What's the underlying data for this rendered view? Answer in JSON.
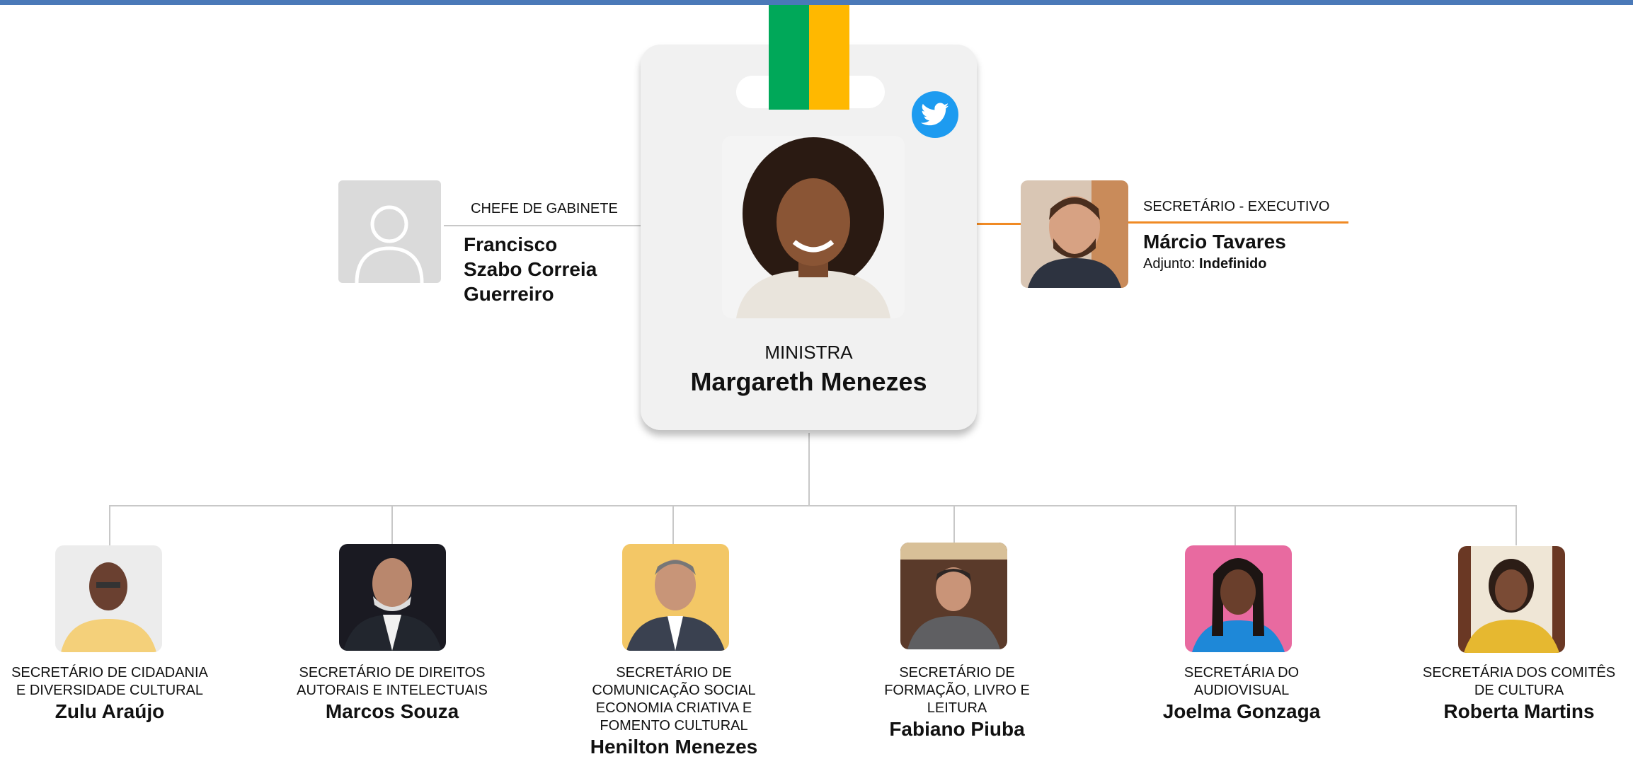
{
  "minister": {
    "role": "MINISTRA",
    "name": "Margareth Menezes",
    "social_icon": "twitter-bird-icon"
  },
  "chief_of_staff": {
    "role": "CHEFE DE GABINETE",
    "name_lines": [
      "Francisco",
      "Szabo Correia",
      "Guerreiro"
    ],
    "photo": "person-placeholder-icon"
  },
  "executive_secretary": {
    "role": "SECRETÁRIO - EXECUTIVO",
    "name": "Márcio Tavares",
    "deputy_label": "Adjunto: ",
    "deputy_value": "Indefinido"
  },
  "secretaries": [
    {
      "role_lines": [
        "SECRETÁRIO DE CIDADANIA",
        "E DIVERSIDADE CULTURAL"
      ],
      "name": "Zulu Araújo"
    },
    {
      "role_lines": [
        "SECRETÁRIO DE DIREITOS",
        "AUTORAIS E INTELECTUAIS"
      ],
      "name": "Marcos Souza"
    },
    {
      "role_lines": [
        "SECRETÁRIO DE",
        "COMUNICAÇÃO SOCIAL",
        "ECONOMIA CRIATIVA E",
        "FOMENTO CULTURAL"
      ],
      "name": "Henilton Menezes"
    },
    {
      "role_lines": [
        "SECRETÁRIO DE",
        "FORMAÇÃO, LIVRO E",
        "LEITURA"
      ],
      "name": "Fabiano Piuba"
    },
    {
      "role_lines": [
        "SECRETÁRIA DO",
        "AUDIOVISUAL"
      ],
      "name": "Joelma Gonzaga"
    },
    {
      "role_lines": [
        "SECRETÁRIA DOS COMITÊS",
        "DE CULTURA"
      ],
      "name": "Roberta Martins"
    }
  ],
  "colors": {
    "top_bar": "#4a79b8",
    "ribbon_green": "#00a859",
    "ribbon_yellow": "#ffb800",
    "twitter": "#1d9bf0",
    "executive_line": "#f08a24",
    "connector": "#c8c8c8",
    "card": "#f1f1f1"
  }
}
